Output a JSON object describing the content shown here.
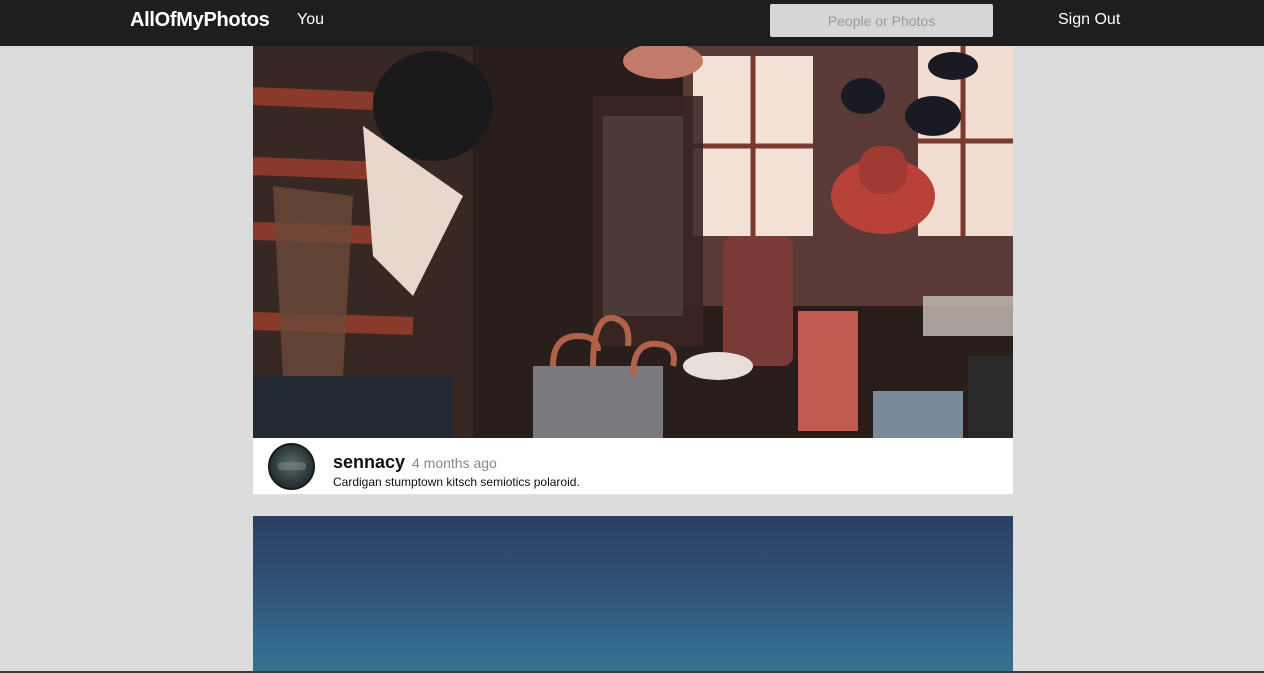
{
  "header": {
    "brand": "AllOfMyPhotos",
    "nav_you": "You",
    "search_placeholder": "People or Photos",
    "sign_out": "Sign Out"
  },
  "posts": [
    {
      "username": "sennacy",
      "timestamp": "4 months ago",
      "caption": "Cardigan stumptown kitsch semiotics polaroid."
    }
  ],
  "colors": {
    "topbar": "#1e1e1e",
    "page_background": "#dcdcdc",
    "search_background": "#d6d6d6"
  }
}
